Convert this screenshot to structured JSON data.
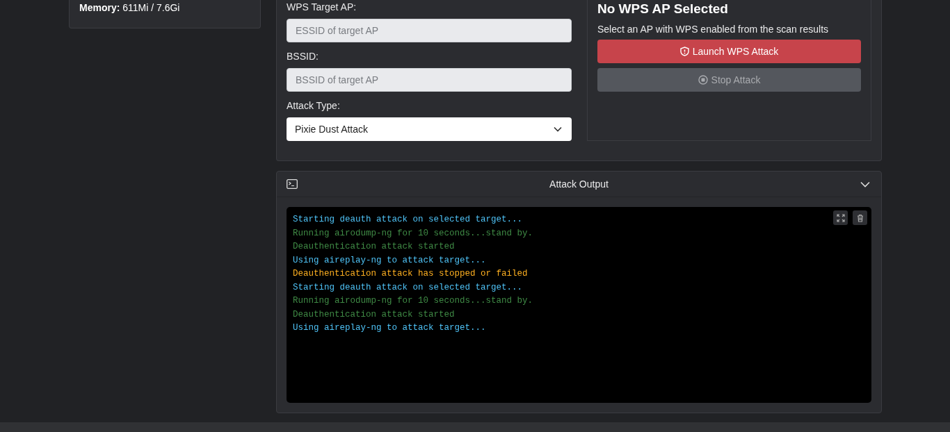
{
  "system_card": {
    "memory": "**Memory:** 611Mi / 7.6Gi"
  },
  "wps_form": {
    "fields": [
      {
        "label": "WPS Target AP:",
        "placeholder": "ESSID of target AP",
        "disabled": true
      },
      {
        "label": "BSSID:",
        "placeholder": "BSSID of target AP",
        "disabled": true
      }
    ],
    "attack_type": {
      "label": "Attack Type:",
      "value": "Pixie Dust Attack"
    }
  },
  "status_card": {
    "title": "No WPS AP Selected",
    "hint": "Select an AP with WPS enabled from the scan results",
    "buttons": [
      {
        "label": "Launch WPS Attack",
        "kind": "launch",
        "disabled": false
      },
      {
        "label": "Stop Attack",
        "kind": "stop",
        "disabled": true
      }
    ]
  },
  "output_panel": {
    "title": "Attack Output",
    "expanded": true,
    "lines": [
      {
        "text": "Starting deauth attack on selected target...",
        "color": "#4fc3f7"
      },
      {
        "text": "Running airodump-ng for 10 seconds...stand by.",
        "color": "#3f8a45"
      },
      {
        "text": "Deauthentication attack started",
        "color": "#3f8a45"
      },
      {
        "text": "Using aireplay-ng to attack target...",
        "color": "#4fc3f7"
      },
      {
        "text": "Deauthentication attack has stopped or failed",
        "color": "#ffb020"
      },
      {
        "text": "Starting deauth attack on selected target...",
        "color": "#4fc3f7"
      },
      {
        "text": "Running airodump-ng for 10 seconds...stand by.",
        "color": "#3f8a45"
      },
      {
        "text": "Deauthentication attack started",
        "color": "#3f8a45"
      },
      {
        "text": "Using aireplay-ng to attack target...",
        "color": "#4fc3f7"
      }
    ]
  }
}
